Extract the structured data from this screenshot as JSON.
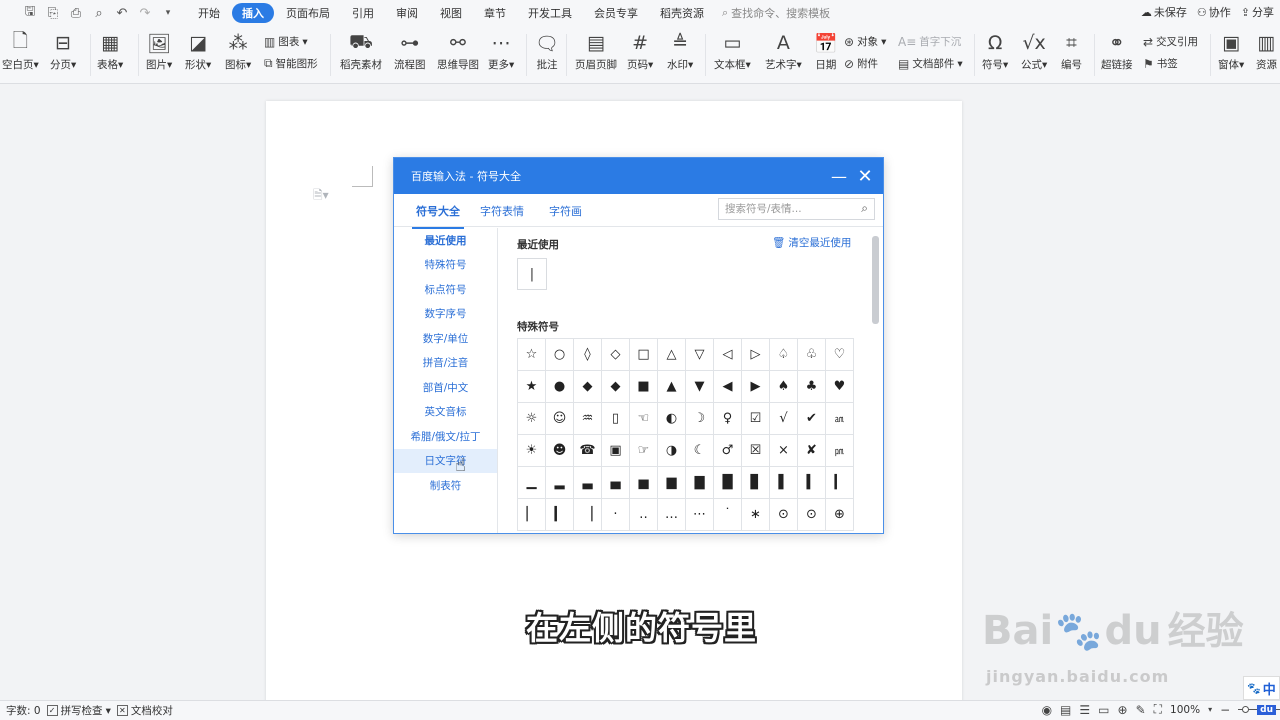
{
  "quick_access": {
    "icons": [
      "save-icon",
      "export-pdf-icon",
      "print-icon",
      "print-preview-icon",
      "undo-icon",
      "redo-icon",
      "more-icon"
    ]
  },
  "menu": {
    "tabs": [
      "开始",
      "插入",
      "页面布局",
      "引用",
      "审阅",
      "视图",
      "章节",
      "开发工具",
      "会员专享",
      "稻壳资源"
    ],
    "active_tab": "插入",
    "search": "查找命令、搜索模板",
    "unsaved": "未保存",
    "collab": "协作",
    "share": "分享"
  },
  "ribbon": {
    "blank_page": "空白页",
    "page_break": "分页",
    "table": "表格",
    "picture": "图片",
    "shape": "形状",
    "icon": "图标",
    "chart": "图表",
    "smart_art": "智能图形",
    "docer_material": "稻壳素材",
    "flowchart": "流程图",
    "mindmap": "思维导图",
    "more": "更多",
    "comment": "批注",
    "header_footer": "页眉页脚",
    "page_number": "页码",
    "watermark": "水印",
    "textbox": "文本框",
    "wordart": "艺术字",
    "date": "日期",
    "object": "对象",
    "attachment": "附件",
    "drop_cap": "首字下沉",
    "doc_parts": "文档部件",
    "symbol": "符号",
    "formula": "公式",
    "numbering": "编号",
    "hyperlink": "超链接",
    "cross_ref": "交叉引用",
    "bookmark": "书签",
    "window": "窗体",
    "resource": "资源"
  },
  "dialog": {
    "title": "百度输入法 - 符号大全",
    "tabs": [
      "符号大全",
      "字符表情",
      "字符画"
    ],
    "search_placeholder": "搜索符号/表情...",
    "sidebar": [
      "最近使用",
      "特殊符号",
      "标点符号",
      "数字序号",
      "数字/单位",
      "拼音/注音",
      "部首/中文",
      "英文音标",
      "希腊/俄文/拉丁",
      "日文字符",
      "制表符"
    ],
    "active_sidebar": "最近使用",
    "hover_sidebar": "日文字符",
    "recent_title": "最近使用",
    "clear_recent": "清空最近使用",
    "recent_symbols": [
      "|"
    ],
    "special_title": "特殊符号",
    "special_symbols": [
      "☆",
      "○",
      "◊",
      "◇",
      "□",
      "△",
      "▽",
      "◁",
      "▷",
      "♤",
      "♧",
      "♡",
      "★",
      "●",
      "◆",
      "◆",
      "■",
      "▲",
      "▼",
      "◀",
      "▶",
      "♠",
      "♣",
      "♥",
      "☼",
      "☺",
      "♒",
      "▯",
      "☜",
      "◐",
      "☽",
      "♀",
      "☑",
      "√",
      "✔",
      "㏂",
      "☀",
      "☻",
      "☎",
      "▣",
      "☞",
      "◑",
      "☾",
      "♂",
      "☒",
      "×",
      "✘",
      "㏘",
      "▁",
      "▂",
      "▃",
      "▄",
      "▅",
      "▆",
      "▇",
      "█",
      "▊",
      "▌",
      "▍",
      "▎",
      "▏",
      "▎",
      "▕",
      "·",
      "‥",
      "…",
      "⋯",
      "˙",
      "∗",
      "⊙",
      "⊙",
      "⊕"
    ]
  },
  "caption": "在左侧的符号里",
  "watermark": {
    "brand": "Bai",
    "brand2": "du",
    "cn": "经验",
    "url": "jingyan.baidu.com"
  },
  "status": {
    "word_count": "字数: 0",
    "spell_check": "拼写检查",
    "doc_check": "文档校对",
    "zoom": "100%",
    "ime": "中"
  }
}
